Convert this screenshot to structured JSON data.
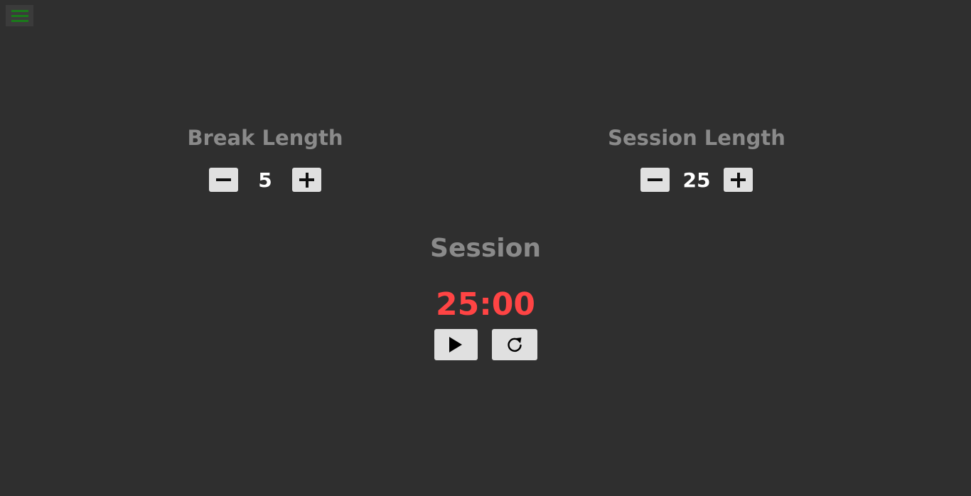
{
  "break": {
    "label": "Break Length",
    "value": "5"
  },
  "session": {
    "label": "Session Length",
    "value": "25"
  },
  "timer": {
    "label": "Session",
    "display": "25:00"
  },
  "icons": {
    "menu": "hamburger-menu-icon",
    "decrement": "minus-icon",
    "increment": "plus-icon",
    "start": "play-icon",
    "reset": "refresh-icon"
  },
  "colors": {
    "background": "#2f2f2f",
    "label": "#8a8a8a",
    "timer": "#ff4444",
    "menu": "#1a7a1a",
    "button": "#e0e0e0"
  }
}
